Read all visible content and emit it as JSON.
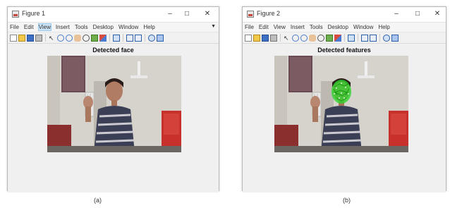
{
  "figures": [
    {
      "window_title": "Figure 1",
      "menu": [
        "File",
        "Edit",
        "View",
        "Insert",
        "Tools",
        "Desktop",
        "Window",
        "Help"
      ],
      "active_menu": "View",
      "axes_title": "Detected face",
      "caption": "(a)",
      "detection_overlay": false
    },
    {
      "window_title": "Figure 2",
      "menu": [
        "File",
        "Edit",
        "View",
        "Insert",
        "Tools",
        "Desktop",
        "Window",
        "Help"
      ],
      "active_menu": "",
      "axes_title": "Detected features",
      "caption": "(b)",
      "detection_overlay": true,
      "overlay_color": "#2bd62b"
    }
  ],
  "window_controls": [
    "minimize-icon",
    "maximize-icon",
    "close-icon"
  ],
  "toolbar_icons": [
    "new-figure-icon",
    "open-file-icon",
    "save-icon",
    "print-icon",
    "separator",
    "pointer-icon",
    "zoom-in-icon",
    "zoom-out-icon",
    "pan-icon",
    "rotate-icon",
    "data-cursor-icon",
    "brush-icon",
    "separator",
    "link-plot-icon",
    "separator",
    "insert-colorbar-icon",
    "insert-legend-icon",
    "separator",
    "hide-plot-tools-icon",
    "show-plot-tools-icon"
  ]
}
